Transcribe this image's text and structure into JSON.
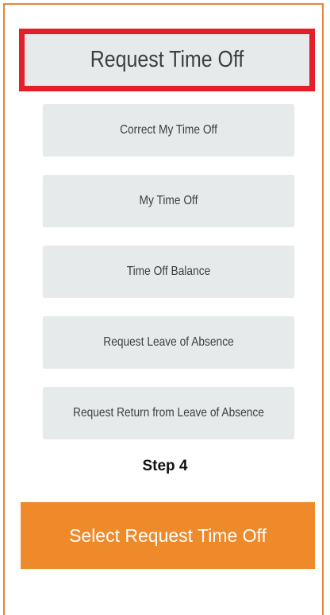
{
  "menu": {
    "highlighted_label": "Request Time Off",
    "items": [
      {
        "label": "Correct My Time Off"
      },
      {
        "label": "My Time Off"
      },
      {
        "label": "Time Off Balance"
      },
      {
        "label": "Request Leave of Absence"
      },
      {
        "label": "Request Return from Leave of Absence"
      }
    ]
  },
  "step": {
    "label": "Step 4"
  },
  "instruction": {
    "label": "Select Request Time Off"
  },
  "colors": {
    "frame_border": "#e8833a",
    "highlight_border": "#e3202a",
    "menu_background": "#e7eaeb",
    "cta_background": "#ef8a2b"
  }
}
